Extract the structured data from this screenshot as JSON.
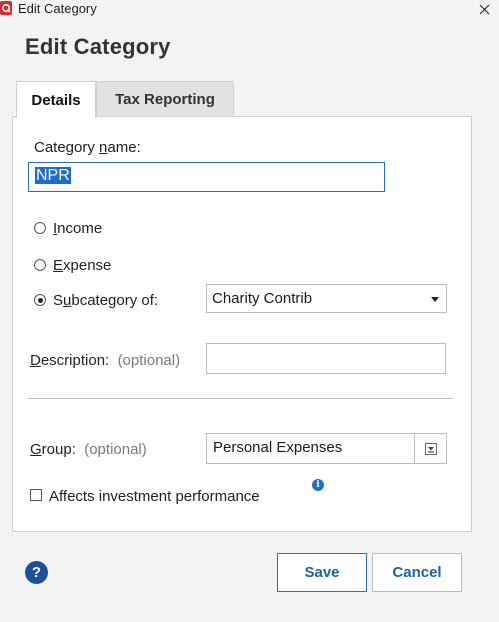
{
  "window": {
    "title": "Edit Category"
  },
  "dialog": {
    "heading": "Edit Category"
  },
  "tabs": [
    {
      "label": "Details",
      "active": true
    },
    {
      "label": "Tax Reporting",
      "active": false
    }
  ],
  "form": {
    "category_name_label_pre": "Category ",
    "category_name_label_ul": "n",
    "category_name_label_post": "ame:",
    "category_name_value": "NPR",
    "radios": {
      "income": {
        "ul": "I",
        "rest": "ncome",
        "checked": false
      },
      "expense": {
        "ul": "E",
        "rest": "xpense",
        "checked": false
      },
      "subcategory": {
        "pre": "S",
        "ul": "u",
        "rest": "bcategory of:",
        "checked": true
      }
    },
    "subcategory_value": "Charity Contrib",
    "description_label_ul": "D",
    "description_label_rest": "escription:",
    "description_optional": "(optional)",
    "description_value": "",
    "group_label_ul": "G",
    "group_label_rest": "roup:",
    "group_optional": "(optional)",
    "group_value": "Personal Expenses",
    "affects_investment_label": "Affects investment performance",
    "affects_investment_checked": false
  },
  "buttons": {
    "save": "Save",
    "cancel": "Cancel"
  },
  "icons": {
    "app": "quicken-app-icon",
    "close": "close-icon",
    "dropdown": "chevron-down-icon",
    "group_picker": "download-tray-icon",
    "info": "info-icon",
    "help": "help-icon"
  },
  "colors": {
    "accent": "#1d6fc9",
    "app_red": "#d7282f",
    "button_text": "#1d5fa8"
  }
}
